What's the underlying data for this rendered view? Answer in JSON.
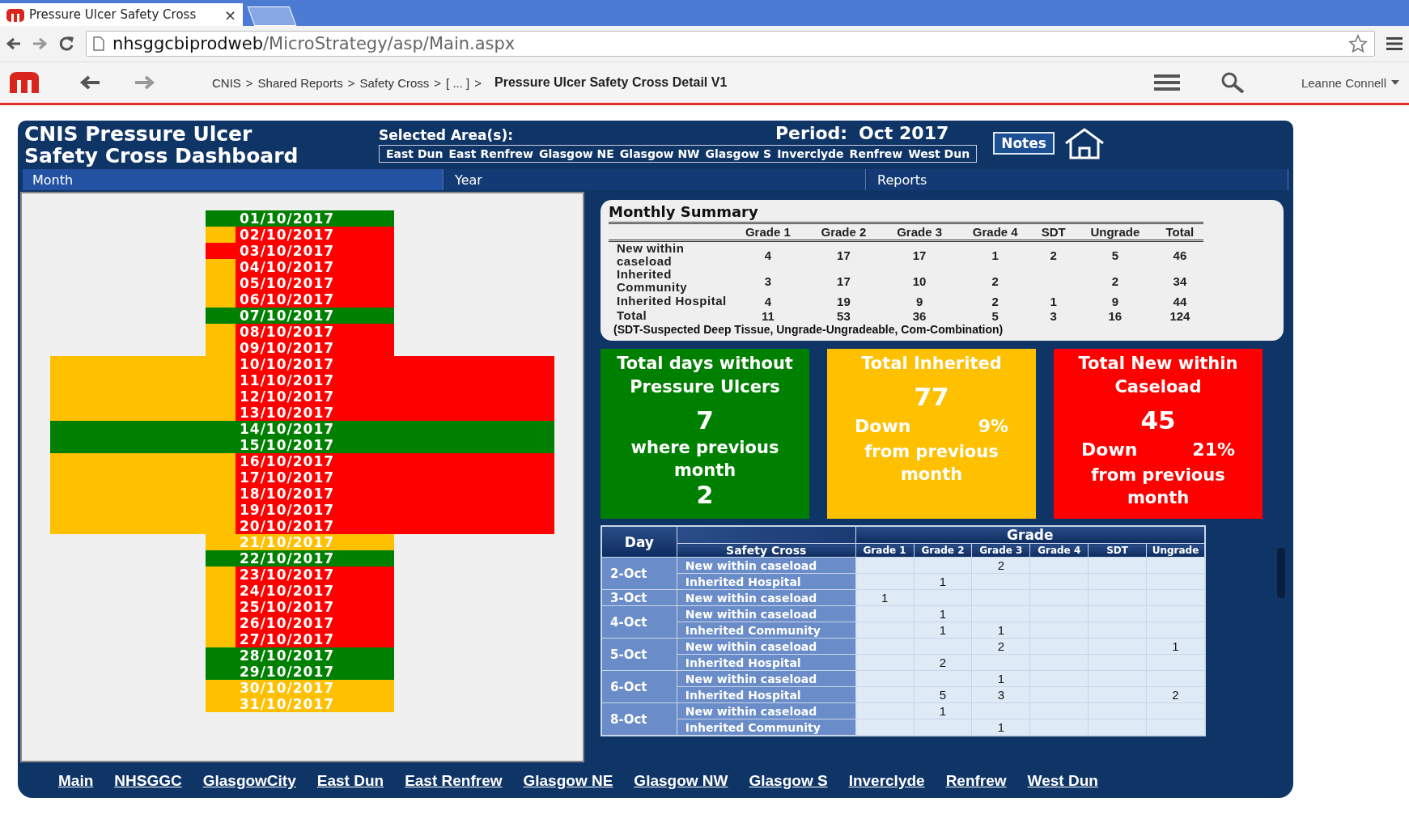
{
  "browser": {
    "tab_title": "Pressure Ulcer Safety Cross",
    "tab_close": "×",
    "url_host": "nhsggcbiprodweb",
    "url_path": "/MicroStrategy/asp/Main.aspx"
  },
  "toolbar": {
    "breadcrumb_separator": ">",
    "breadcrumb": [
      {
        "label": "CNIS",
        "current": false
      },
      {
        "label": "Shared Reports",
        "current": false
      },
      {
        "label": "Safety Cross",
        "current": false
      },
      {
        "label": "[ ... ]",
        "current": false
      },
      {
        "label": "Pressure Ulcer Safety Cross Detail V1",
        "current": true
      }
    ],
    "user": "Leanne Connell"
  },
  "header": {
    "title_lines": [
      "CNIS Pressure Ulcer",
      "Safety Cross Dashboard"
    ],
    "selected_label": "Selected Area(s):",
    "areas": [
      "East Dun",
      "East Renfrew",
      "Glasgow NE",
      "Glasgow NW",
      "Glasgow S",
      "Inverclyde",
      "Renfrew",
      "West Dun"
    ],
    "period_label": "Period:",
    "period": "Oct 2017",
    "notes_button": "Notes"
  },
  "tabs": [
    {
      "label": "Month",
      "selected": true
    },
    {
      "label": "Year",
      "selected": false
    },
    {
      "label": "Reports",
      "selected": false
    }
  ],
  "cross": {
    "days": [
      {
        "date": "01/10/2017",
        "color": "#008000",
        "strip": {
          "color": "#008000"
        },
        "wide": false
      },
      {
        "date": "02/10/2017",
        "color": "#ff0000",
        "strip": {
          "color": "#ffc000"
        },
        "wide": false
      },
      {
        "date": "03/10/2017",
        "color": "#ff0000",
        "strip": {
          "color": "#ff0000"
        },
        "wide": false
      },
      {
        "date": "04/10/2017",
        "color": "#ff0000",
        "strip": {
          "color": "#ffc000"
        },
        "wide": false
      },
      {
        "date": "05/10/2017",
        "color": "#ff0000",
        "strip": {
          "color": "#ffc000"
        },
        "wide": false
      },
      {
        "date": "06/10/2017",
        "color": "#ff0000",
        "strip": {
          "color": "#ffc000"
        },
        "wide": false
      },
      {
        "date": "07/10/2017",
        "color": "#008000",
        "strip": {
          "color": "#008000"
        },
        "wide": false
      },
      {
        "date": "08/10/2017",
        "color": "#ff0000",
        "strip": {
          "color": "#ffc000"
        },
        "wide": false
      },
      {
        "date": "09/10/2017",
        "color": "#ff0000",
        "strip": {
          "color": "#ffc000"
        },
        "wide": false
      },
      {
        "date": "10/10/2017",
        "color": "#ff0000",
        "strip": {
          "color": "#ffc000"
        },
        "wide": true
      },
      {
        "date": "11/10/2017",
        "color": "#ff0000",
        "strip": {
          "color": "#ffc000"
        },
        "wide": true
      },
      {
        "date": "12/10/2017",
        "color": "#ff0000",
        "strip": {
          "color": "#ffc000"
        },
        "wide": true
      },
      {
        "date": "13/10/2017",
        "color": "#ff0000",
        "strip": {
          "color": "#ffc000"
        },
        "wide": true
      },
      {
        "date": "14/10/2017",
        "color": "#008000",
        "strip": {
          "color": "#008000"
        },
        "wide": true
      },
      {
        "date": "15/10/2017",
        "color": "#008000",
        "strip": {
          "color": "#008000"
        },
        "wide": true
      },
      {
        "date": "16/10/2017",
        "color": "#ff0000",
        "strip": {
          "color": "#ffc000"
        },
        "wide": true
      },
      {
        "date": "17/10/2017",
        "color": "#ff0000",
        "strip": {
          "color": "#ffc000"
        },
        "wide": true
      },
      {
        "date": "18/10/2017",
        "color": "#ff0000",
        "strip": {
          "color": "#ffc000"
        },
        "wide": true
      },
      {
        "date": "19/10/2017",
        "color": "#ff0000",
        "strip": {
          "color": "#ffc000"
        },
        "wide": true
      },
      {
        "date": "20/10/2017",
        "color": "#ff0000",
        "strip": {
          "color": "#ffc000"
        },
        "wide": true
      },
      {
        "date": "21/10/2017",
        "color": "#ffc000",
        "strip": {
          "color": "#ffc000"
        },
        "wide": false
      },
      {
        "date": "22/10/2017",
        "color": "#008000",
        "strip": {
          "color": "#008000"
        },
        "wide": false
      },
      {
        "date": "23/10/2017",
        "color": "#ff0000",
        "strip": {
          "color": "#ffc000"
        },
        "wide": false
      },
      {
        "date": "24/10/2017",
        "color": "#ff0000",
        "strip": {
          "color": "#ffc000"
        },
        "wide": false
      },
      {
        "date": "25/10/2017",
        "color": "#ff0000",
        "strip": {
          "color": "#ffc000"
        },
        "wide": false
      },
      {
        "date": "26/10/2017",
        "color": "#ff0000",
        "strip": {
          "color": "#ffc000"
        },
        "wide": false
      },
      {
        "date": "27/10/2017",
        "color": "#ff0000",
        "strip": {
          "color": "#ffc000"
        },
        "wide": false
      },
      {
        "date": "28/10/2017",
        "color": "#008000",
        "strip": {
          "color": "#008000"
        },
        "wide": false
      },
      {
        "date": "29/10/2017",
        "color": "#008000",
        "strip": {
          "color": "#008000"
        },
        "wide": false
      },
      {
        "date": "30/10/2017",
        "color": "#ffc000",
        "strip": {
          "color": "#ffc000"
        },
        "wide": false
      },
      {
        "date": "31/10/2017",
        "color": "#ffc000",
        "strip": {
          "color": "#ffc000"
        },
        "wide": false
      }
    ]
  },
  "summary": {
    "title": "Monthly Summary",
    "columns": [
      "Grade 1",
      "Grade 2",
      "Grade 3",
      "Grade 4",
      "SDT",
      "Ungrade",
      "Total"
    ],
    "rows": [
      {
        "label": "New within caseload",
        "cells": [
          {
            "value": "4"
          },
          {
            "value": "17"
          },
          {
            "value": "17"
          },
          {
            "value": "1"
          },
          {
            "value": "2"
          },
          {
            "value": "5"
          },
          {
            "value": "46"
          }
        ]
      },
      {
        "label": "Inherited Community",
        "cells": [
          {
            "value": "3"
          },
          {
            "value": "17"
          },
          {
            "value": "10"
          },
          {
            "value": "2"
          },
          {
            "empty": true
          },
          {
            "value": "2"
          },
          {
            "value": "34"
          }
        ]
      },
      {
        "label": "Inherited  Hospital",
        "cells": [
          {
            "value": "4"
          },
          {
            "value": "19"
          },
          {
            "value": "9"
          },
          {
            "value": "2"
          },
          {
            "value": "1"
          },
          {
            "value": "9"
          },
          {
            "value": "44"
          }
        ]
      },
      {
        "label": "Total",
        "cells": [
          {
            "value": "11"
          },
          {
            "value": "53"
          },
          {
            "value": "36"
          },
          {
            "value": "5"
          },
          {
            "value": "3"
          },
          {
            "value": "16"
          },
          {
            "value": "124"
          }
        ]
      }
    ],
    "note": "(SDT-Suspected Deep Tissue,  Ungrade-Ungradeable,  Com-Combination)"
  },
  "tiles": [
    {
      "color": "#008000",
      "title": "Total days without Pressure Ulcers",
      "value": "7",
      "caption": "where previous month",
      "previous": "2"
    },
    {
      "color": "#ffc000",
      "title": "Total  Inherited",
      "value": "77",
      "trend": "Down",
      "change": "9%",
      "caption": "from previous month"
    },
    {
      "color": "#ff0000",
      "title": "Total New within Caseload",
      "value": "45",
      "trend": "Down",
      "change": "21%",
      "caption": "from previous month"
    }
  ],
  "detail": {
    "day_header": "Day",
    "group_header": "Grade",
    "category_header": "Safety Cross",
    "columns": [
      "Grade 1",
      "Grade 2",
      "Grade 3",
      "Grade 4",
      "SDT",
      "Ungrade"
    ],
    "days": [
      {
        "day": "2-Oct",
        "rows": [
          {
            "label": "New within caseload",
            "cells": [
              {
                "empty": true
              },
              {
                "empty": true
              },
              {
                "value": "2"
              },
              {
                "empty": true
              },
              {
                "empty": true
              },
              {
                "empty": true
              }
            ]
          },
          {
            "label": "Inherited  Hospital",
            "cells": [
              {
                "empty": true
              },
              {
                "value": "1"
              },
              {
                "empty": true
              },
              {
                "empty": true
              },
              {
                "empty": true
              },
              {
                "empty": true
              }
            ]
          }
        ]
      },
      {
        "day": "3-Oct",
        "rows": [
          {
            "label": "New within caseload",
            "cells": [
              {
                "value": "1"
              },
              {
                "empty": true
              },
              {
                "empty": true
              },
              {
                "empty": true
              },
              {
                "empty": true
              },
              {
                "empty": true
              }
            ]
          }
        ]
      },
      {
        "day": "4-Oct",
        "rows": [
          {
            "label": "New within caseload",
            "cells": [
              {
                "empty": true
              },
              {
                "value": "1"
              },
              {
                "empty": true
              },
              {
                "empty": true
              },
              {
                "empty": true
              },
              {
                "empty": true
              }
            ]
          },
          {
            "label": "Inherited Community",
            "cells": [
              {
                "empty": true
              },
              {
                "value": "1"
              },
              {
                "value": "1"
              },
              {
                "empty": true
              },
              {
                "empty": true
              },
              {
                "empty": true
              }
            ]
          }
        ]
      },
      {
        "day": "5-Oct",
        "rows": [
          {
            "label": "New within caseload",
            "cells": [
              {
                "empty": true
              },
              {
                "empty": true
              },
              {
                "value": "2"
              },
              {
                "empty": true
              },
              {
                "empty": true
              },
              {
                "value": "1"
              }
            ]
          },
          {
            "label": "Inherited  Hospital",
            "cells": [
              {
                "empty": true
              },
              {
                "value": "2"
              },
              {
                "empty": true
              },
              {
                "empty": true
              },
              {
                "empty": true
              },
              {
                "empty": true
              }
            ]
          }
        ]
      },
      {
        "day": "6-Oct",
        "rows": [
          {
            "label": "New within caseload",
            "cells": [
              {
                "empty": true
              },
              {
                "empty": true
              },
              {
                "value": "1"
              },
              {
                "empty": true
              },
              {
                "empty": true
              },
              {
                "empty": true
              }
            ]
          },
          {
            "label": "Inherited  Hospital",
            "cells": [
              {
                "empty": true
              },
              {
                "value": "5"
              },
              {
                "value": "3"
              },
              {
                "empty": true
              },
              {
                "empty": true
              },
              {
                "value": "2"
              }
            ]
          }
        ]
      },
      {
        "day": "8-Oct",
        "rows": [
          {
            "label": "New within caseload",
            "cells": [
              {
                "empty": true
              },
              {
                "value": "1"
              },
              {
                "empty": true
              },
              {
                "empty": true
              },
              {
                "empty": true
              },
              {
                "empty": true
              }
            ]
          },
          {
            "label": "Inherited Community",
            "cells": [
              {
                "empty": true
              },
              {
                "empty": true
              },
              {
                "value": "1"
              },
              {
                "empty": true
              },
              {
                "empty": true
              },
              {
                "empty": true
              }
            ]
          }
        ]
      }
    ]
  },
  "footer_links": [
    "Main",
    "NHSGGC",
    "GlasgowCity",
    "East Dun",
    "East Renfrew",
    "Glasgow NE",
    "Glasgow NW",
    "Glasgow S",
    "Inverclyde",
    "Renfrew",
    "West Dun"
  ]
}
